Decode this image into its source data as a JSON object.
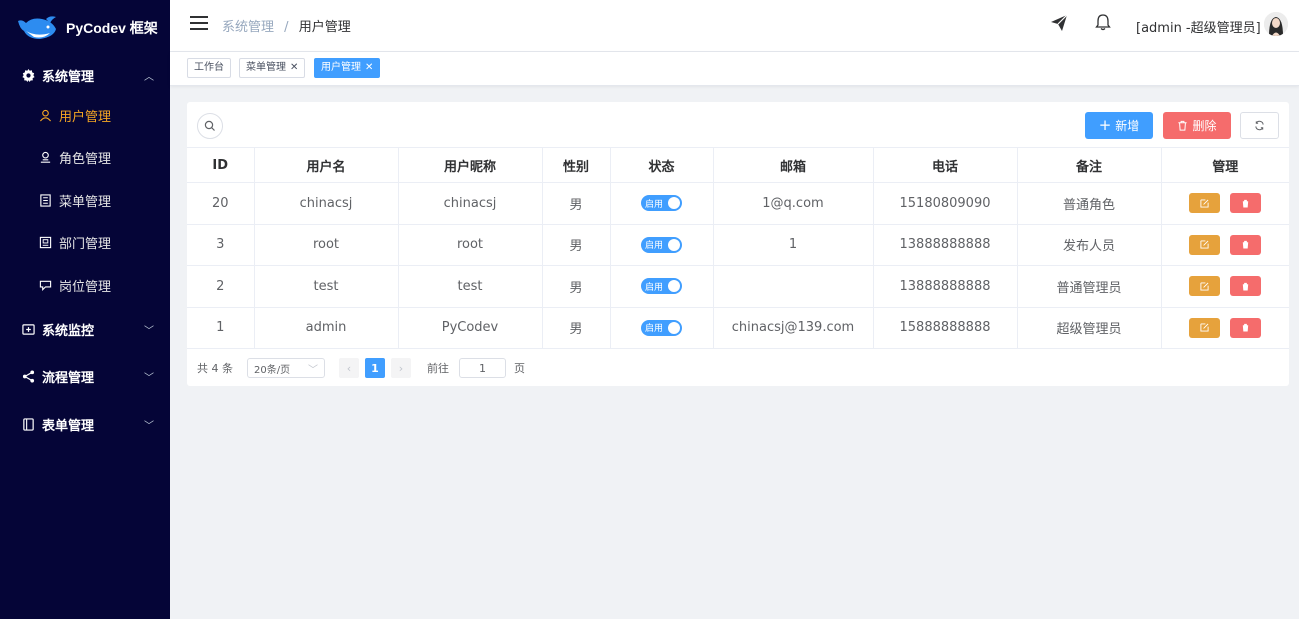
{
  "app": {
    "title": "PyCodev 框架"
  },
  "sidebar": {
    "groups": [
      {
        "label": "系统管理",
        "icon": "gear-icon",
        "expanded": true,
        "items": [
          {
            "label": "用户管理",
            "icon": "user-icon",
            "active": true
          },
          {
            "label": "角色管理",
            "icon": "role-icon"
          },
          {
            "label": "菜单管理",
            "icon": "menu-list-icon"
          },
          {
            "label": "部门管理",
            "icon": "department-icon"
          },
          {
            "label": "岗位管理",
            "icon": "post-icon"
          }
        ]
      },
      {
        "label": "系统监控",
        "icon": "monitor-icon"
      },
      {
        "label": "流程管理",
        "icon": "share-icon"
      },
      {
        "label": "表单管理",
        "icon": "form-icon"
      }
    ]
  },
  "header": {
    "breadcrumb": [
      "系统管理",
      "用户管理"
    ],
    "breadcrumb_sep": "/",
    "user_label": "[admin -超级管理员]"
  },
  "tags": [
    {
      "label": "工作台",
      "closable": false
    },
    {
      "label": "菜单管理",
      "closable": true
    },
    {
      "label": "用户管理",
      "closable": true,
      "active": true
    }
  ],
  "toolbar": {
    "add_label": "新增",
    "delete_label": "删除"
  },
  "table": {
    "columns": [
      "ID",
      "用户名",
      "用户昵称",
      "性别",
      "状态",
      "邮箱",
      "电话",
      "备注",
      "管理"
    ],
    "rows": [
      {
        "id": "20",
        "username": "chinacsj",
        "nickname": "chinacsj",
        "gender": "男",
        "status": "启用",
        "email": "1@q.com",
        "phone": "15180809090",
        "remark": "普通角色"
      },
      {
        "id": "3",
        "username": "root",
        "nickname": "root",
        "gender": "男",
        "status": "启用",
        "email": "1",
        "phone": "13888888888",
        "remark": "发布人员"
      },
      {
        "id": "2",
        "username": "test",
        "nickname": "test",
        "gender": "男",
        "status": "启用",
        "email": "",
        "phone": "13888888888",
        "remark": "普通管理员"
      },
      {
        "id": "1",
        "username": "admin",
        "nickname": "PyCodev",
        "gender": "男",
        "status": "启用",
        "email": "chinacsj@139.com",
        "phone": "15888888888",
        "remark": "超级管理员"
      }
    ]
  },
  "pagination": {
    "total_text": "共 4 条",
    "page_size": "20条/页",
    "current_page": "1",
    "goto_label": "前往",
    "goto_value": "1",
    "page_unit": "页"
  },
  "colors": {
    "sidebar_bg": "#050537",
    "active_menu": "#f5a623",
    "primary": "#409eff",
    "danger": "#f56c6c",
    "warning": "#e6a23c"
  }
}
